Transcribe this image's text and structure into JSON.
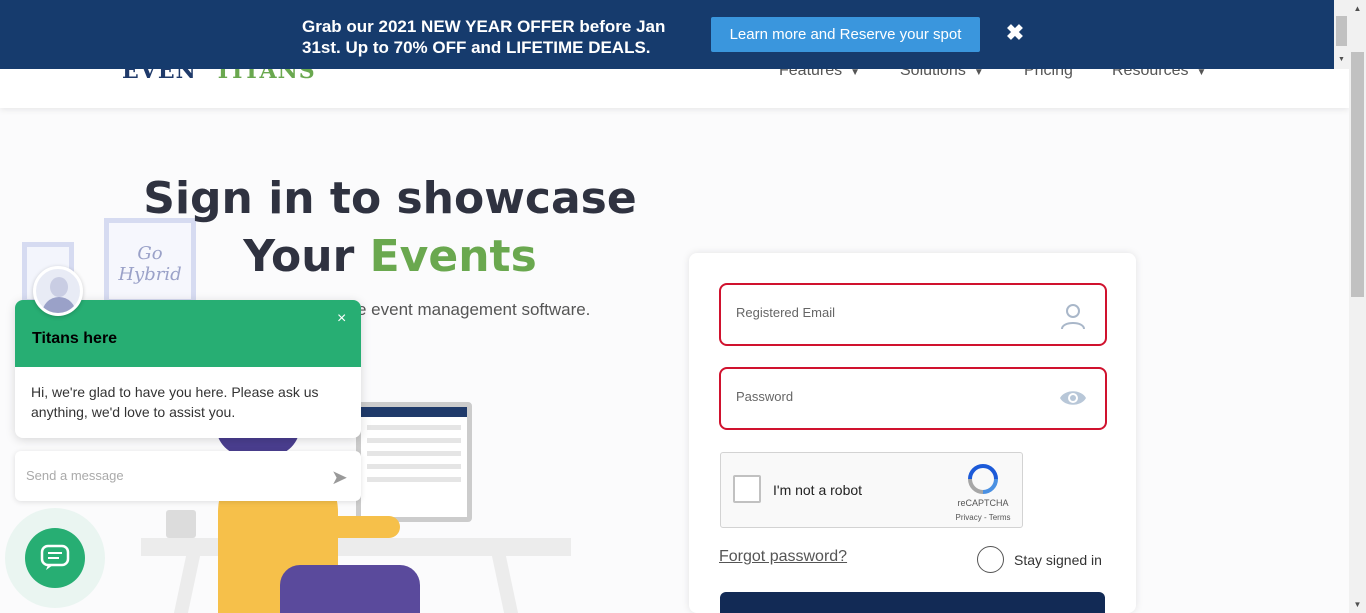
{
  "promo": {
    "text": "Grab our 2021 NEW YEAR OFFER before Jan 31st. Up to 70% OFF and LIFETIME DEALS.",
    "button_label": "Learn more and Reserve your spot",
    "close_glyph": "✖",
    "bg_color": "#163b6d",
    "button_color": "#3a96dd"
  },
  "header": {
    "logo_part1": "EVEN",
    "logo_part2": "TITANS",
    "nav": [
      {
        "label": "Features",
        "has_dropdown": true
      },
      {
        "label": "Solutions",
        "has_dropdown": true
      },
      {
        "label": "Pricing",
        "has_dropdown": false
      },
      {
        "label": "Resources",
        "has_dropdown": true
      }
    ]
  },
  "hero": {
    "title_line1": "Sign in to showcase",
    "title_line2_a": "Your ",
    "title_line2_b": "Events",
    "subtitle": "e event management software.",
    "illustration_text": "Go Hybrid",
    "accent_color": "#6aa84f"
  },
  "chat": {
    "title": "Titans here",
    "close_glyph": "×",
    "message": "Hi, we're glad to have you here. Please ask us anything, we'd love to assist you.",
    "input_placeholder": "Send a message",
    "brand_color": "#27ae73"
  },
  "form": {
    "email_placeholder": "Registered Email",
    "password_placeholder": "Password",
    "captcha_label": "I'm not a robot",
    "captcha_brand": "reCAPTCHA",
    "captcha_terms": "Privacy - Terms",
    "forgot_label": "Forgot password?",
    "stay_signed_in_label": "Stay signed in",
    "error_color": "#d0122e",
    "submit_color": "#122a55"
  }
}
